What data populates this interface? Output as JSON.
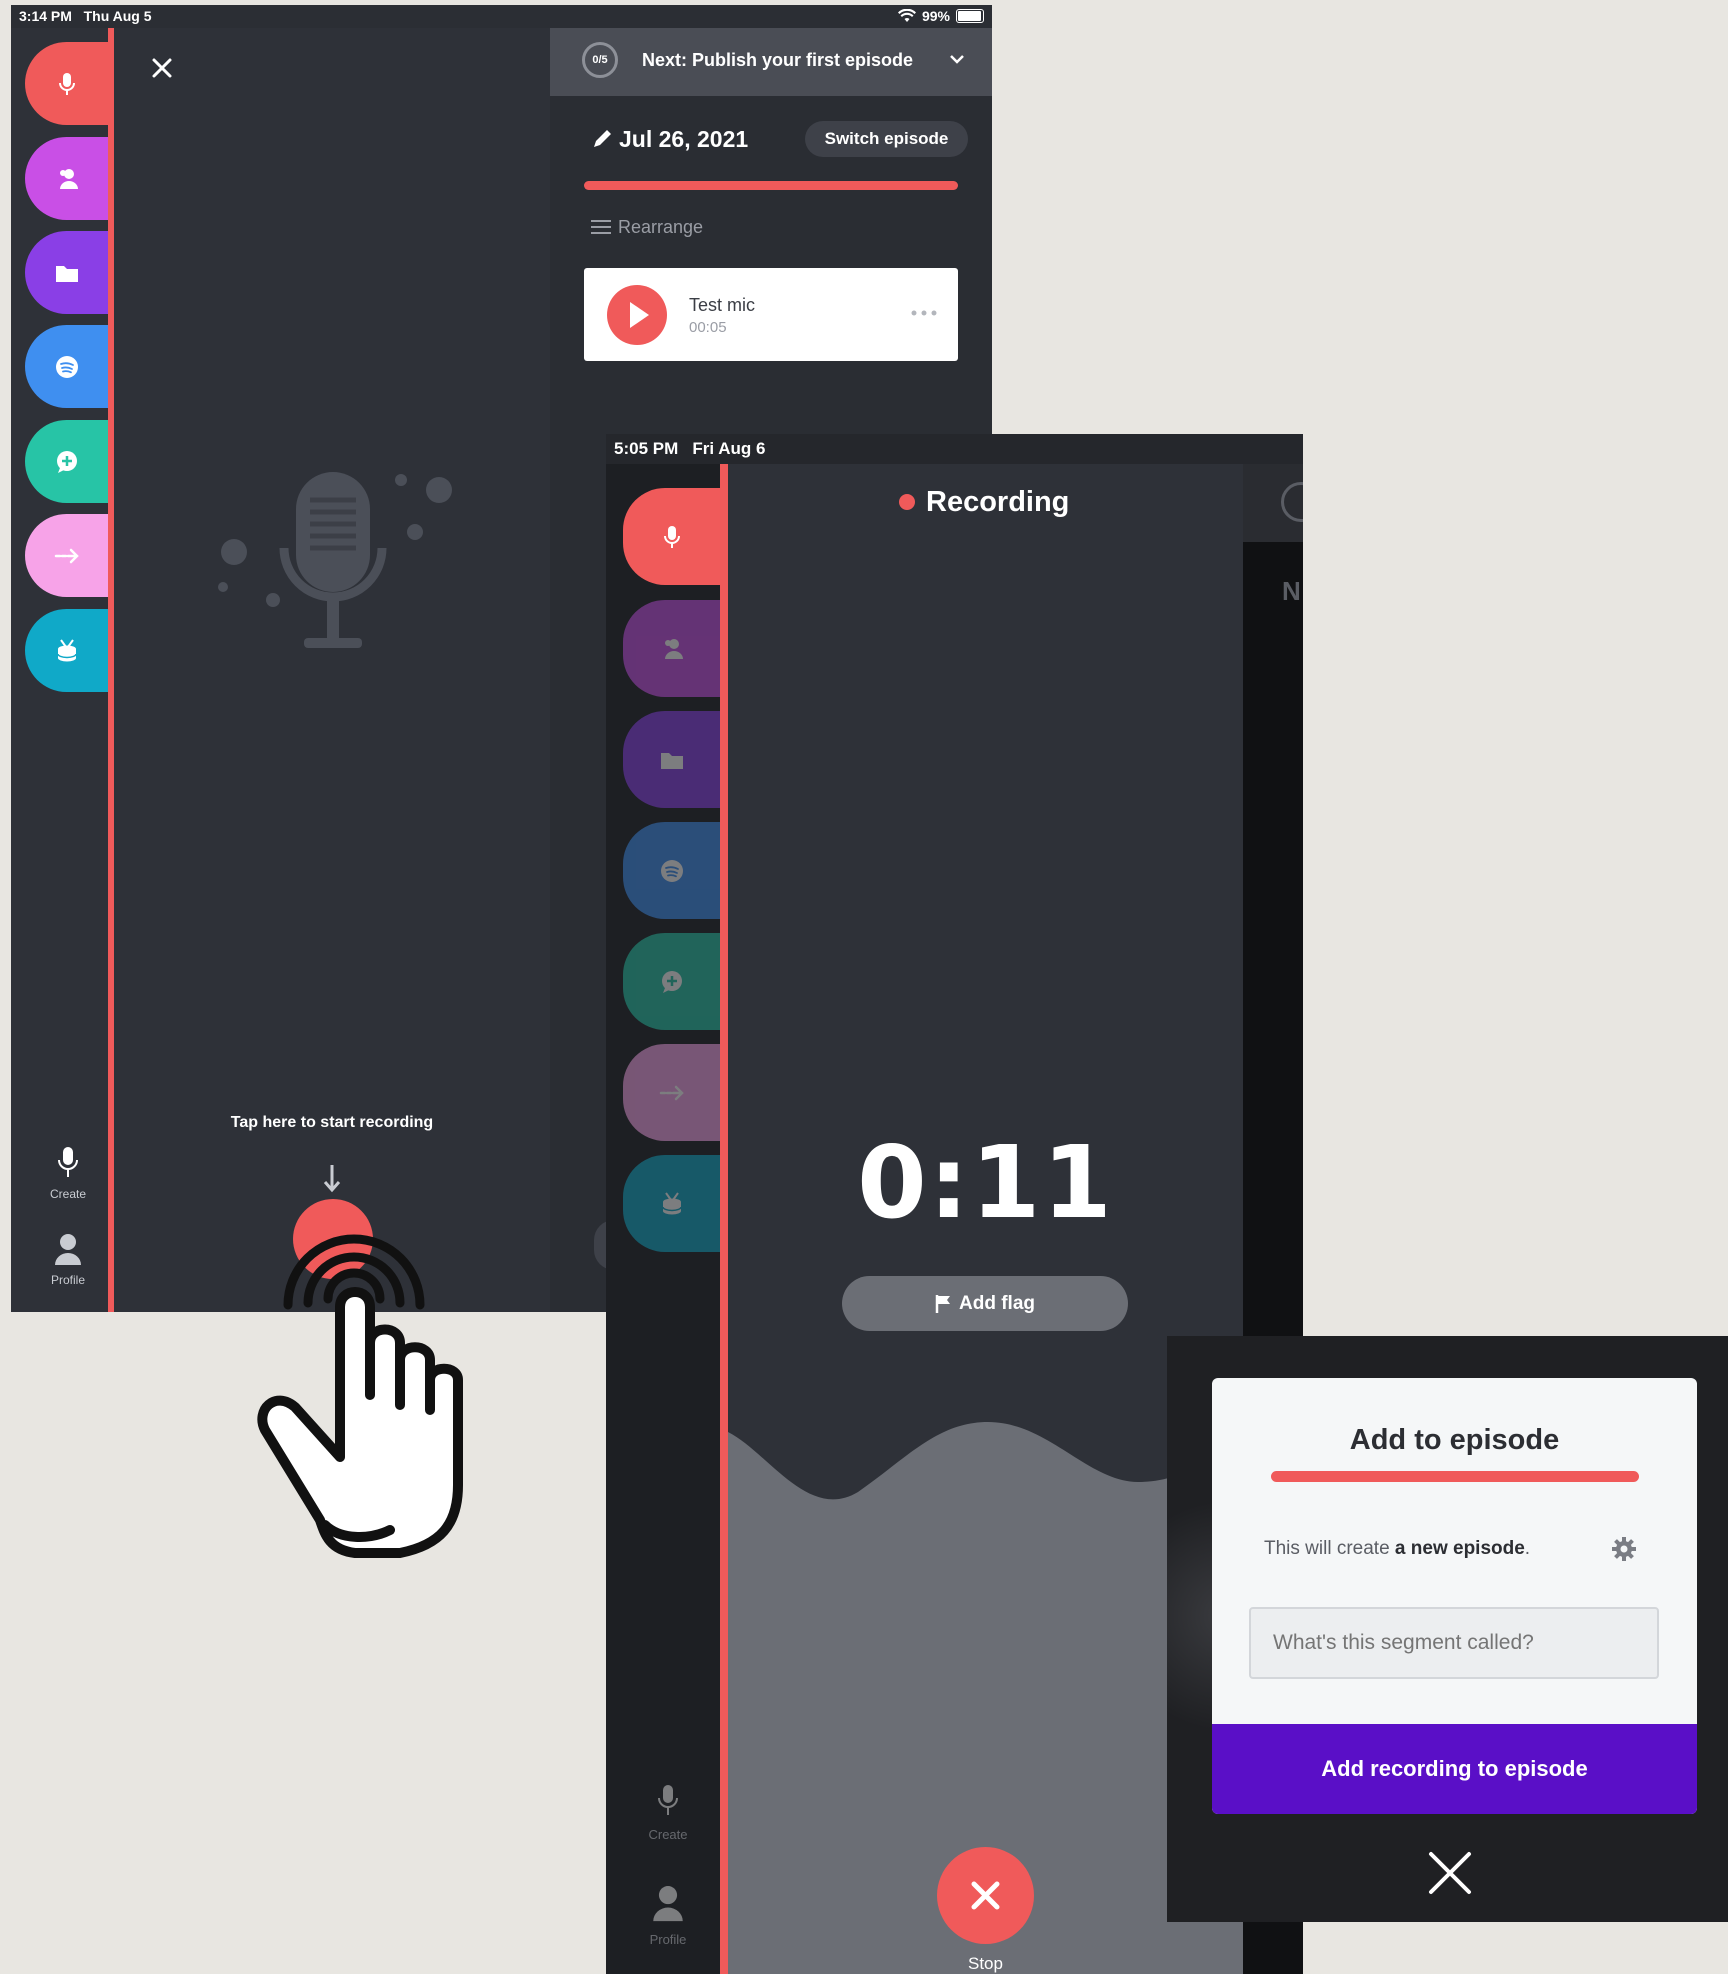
{
  "screen1": {
    "status": {
      "time": "3:14 PM",
      "date": "Thu Aug 5",
      "battery": "99%"
    },
    "progress_badge": "0/5",
    "next_step": "Next: Publish your first episode",
    "episode_date": "Jul 26, 2021",
    "switch_episode": "Switch episode",
    "rearrange": "Rearrange",
    "segment": {
      "title": "Test mic",
      "duration": "00:05"
    },
    "hint": "Tap here to start recording",
    "nav": {
      "create": "Create",
      "profile": "Profile"
    }
  },
  "screen2": {
    "status": {
      "time": "5:05 PM",
      "date": "Fri Aug 6"
    },
    "recording_label": "Recording",
    "timer": "0:11",
    "add_flag": "Add flag",
    "stop": "Stop",
    "nav": {
      "create": "Create",
      "profile": "Profile"
    },
    "peek_letter": "N"
  },
  "dialog": {
    "title": "Add to episode",
    "info_prefix": "This will create ",
    "info_bold": "a new episode",
    "info_suffix": ".",
    "input_placeholder": "What's this segment called?",
    "submit": "Add recording to episode"
  },
  "colors": {
    "coral": "#f05a5a",
    "magenta": "#c94fe6",
    "purple": "#8a3fe6",
    "blue": "#3f8ff0",
    "teal": "#27c4a6",
    "pink": "#f7a3e8",
    "cyan": "#10a9c8",
    "dialog_button": "#5a0fc7"
  },
  "icons": [
    "microphone-icon",
    "contacts-icon",
    "folder-icon",
    "spotify-icon",
    "chat-plus-icon",
    "share-arrow-icon",
    "drum-icon",
    "close-icon",
    "pencil-icon",
    "chevron-down-icon",
    "menu-lines-icon",
    "play-icon",
    "more-icon",
    "flag-icon",
    "gear-icon",
    "tap-hand-icon"
  ]
}
